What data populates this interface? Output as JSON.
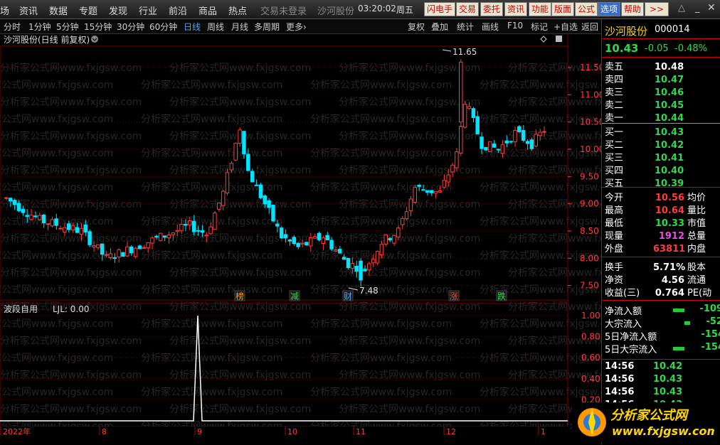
{
  "menubar": {
    "items": [
      "场",
      "资讯",
      "数据",
      "专题",
      "发现",
      "行业",
      "前沿",
      "商品",
      "热点"
    ],
    "status": "交易未登录",
    "stock_name": "沙河股份",
    "time": "03:20:02",
    "weekday": "周五",
    "buttons": [
      "闪电手",
      "交易",
      "委托",
      "资讯",
      "功能",
      "版面",
      "公式",
      "选项",
      "帮助",
      ">>"
    ],
    "highlight_button": "选项"
  },
  "toolbar": {
    "periods": [
      "分时",
      "1分钟",
      "5分钟",
      "15分钟",
      "30分钟",
      "60分钟",
      "日线",
      "周线",
      "月线",
      "多周期",
      "更多"
    ],
    "active_period": "日线",
    "right_tools": [
      "复权",
      "叠加",
      "统计",
      "画线",
      "F10",
      "标记",
      "+自选",
      "返回"
    ]
  },
  "main_chart": {
    "title": "沙河股份(日线 前复权)",
    "watermark": "分析家公式网www.fxjgsw.com",
    "high_marker": "11.65",
    "low_marker": "7.48",
    "event_tags": [
      {
        "text": "榜",
        "color": "#ff9900"
      },
      {
        "text": "减",
        "color": "#2fd94a"
      },
      {
        "text": "财",
        "color": "#4aa3ff"
      },
      {
        "text": "涨",
        "color": "#ff3b3b"
      },
      {
        "text": "跌",
        "color": "#2fd94a"
      }
    ],
    "y_ticks": [
      "11.50",
      "11.00",
      "10.50",
      "10.00",
      "9.50",
      "9.00",
      "8.50",
      "8.00",
      "7.50"
    ]
  },
  "sub_chart": {
    "title": "波段自用",
    "value_label": "LJL: 0.00",
    "y_ticks": [
      "1.00",
      "0.80",
      "0.60",
      "0.40",
      "0.20"
    ],
    "x_labels": [
      "2022年",
      "8",
      "9",
      "10",
      "11",
      "12",
      "1"
    ]
  },
  "chart_data": [
    {
      "type": "candlestick",
      "title": "沙河股份(日线 前复权)",
      "ylim": [
        7.3,
        11.8
      ],
      "high": 11.65,
      "low": 7.48
    },
    {
      "type": "line",
      "title": "波段自用",
      "series": [
        {
          "name": "LJL",
          "values": [
            0,
            0,
            1.0,
            0,
            0
          ]
        }
      ],
      "ylim": [
        0,
        1.1
      ]
    }
  ],
  "quote": {
    "name": "沙河股份",
    "code": "000014",
    "price": "10.43",
    "change": "-0.05",
    "pct": "-0.48%",
    "asks": [
      {
        "label": "卖五",
        "price": "10.48",
        "color": "white"
      },
      {
        "label": "卖四",
        "price": "10.47",
        "color": "green"
      },
      {
        "label": "卖三",
        "price": "10.46",
        "color": "green"
      },
      {
        "label": "卖二",
        "price": "10.45",
        "color": "green"
      },
      {
        "label": "卖一",
        "price": "10.44",
        "color": "green"
      }
    ],
    "bids": [
      {
        "label": "买一",
        "price": "10.43",
        "color": "green"
      },
      {
        "label": "买二",
        "price": "10.42",
        "color": "green"
      },
      {
        "label": "买三",
        "price": "10.41",
        "color": "green"
      },
      {
        "label": "买四",
        "price": "10.40",
        "color": "green"
      },
      {
        "label": "买五",
        "price": "10.39",
        "color": "green"
      }
    ],
    "stats": [
      {
        "label": "今开",
        "value": "10.56",
        "color": "red",
        "label2": "均价"
      },
      {
        "label": "最高",
        "value": "10.64",
        "color": "red",
        "label2": "量比"
      },
      {
        "label": "最低",
        "value": "10.33",
        "color": "green",
        "label2": "市值"
      },
      {
        "label": "现量",
        "value": "1912",
        "color": "magenta",
        "label2": "总量"
      },
      {
        "label": "外盘",
        "value": "63811",
        "color": "red",
        "label2": "内盘"
      }
    ],
    "stats2": [
      {
        "label": "换手",
        "value": "5.71%",
        "label2": "股本"
      },
      {
        "label": "净资",
        "value": "4.56",
        "label2": "流通"
      },
      {
        "label": "收益(三)",
        "value": "0.764",
        "label2": "PE(动"
      }
    ],
    "flows": [
      {
        "label": "净流入额",
        "value": "-109"
      },
      {
        "label": "大宗流入",
        "value": "-52"
      },
      {
        "label": "5日净流入额",
        "value": "-154"
      },
      {
        "label": "5日大宗流入",
        "value": "-154"
      }
    ],
    "ticks": [
      {
        "time": "14:56",
        "price": "10.42"
      },
      {
        "time": "14:56",
        "price": "10.43"
      },
      {
        "time": "14:56",
        "price": "10.43"
      },
      {
        "time": "14:56",
        "price": "10.43"
      }
    ]
  },
  "logo": {
    "text": "分析家公式网",
    "url": "www.fxjgsw.com"
  }
}
